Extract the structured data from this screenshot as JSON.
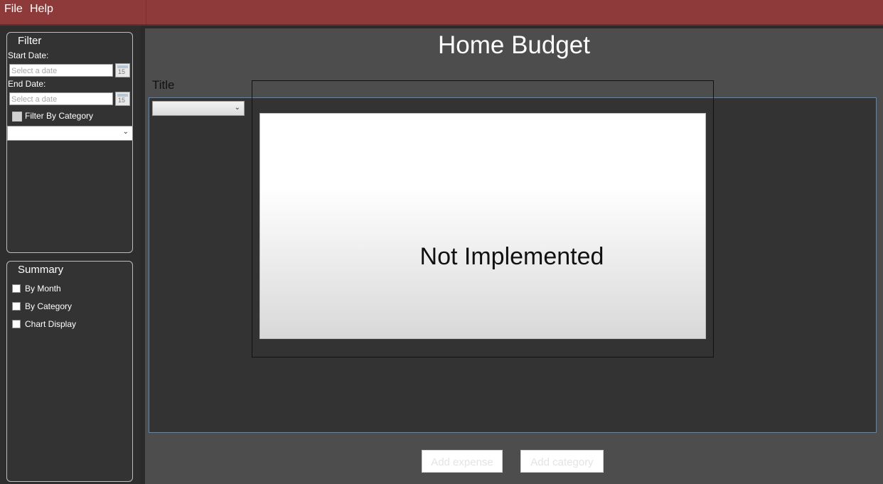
{
  "menu": {
    "file": "File",
    "help": "Help"
  },
  "filter": {
    "title": "Filter",
    "start_label": "Start Date:",
    "end_label": "End Date:",
    "date_placeholder": "Select a date",
    "calendar_day": "15",
    "filter_by_category": "Filter By Category",
    "category_value": ""
  },
  "summary": {
    "title": "Summary",
    "options": [
      "By Month",
      "By Category",
      "Chart Display"
    ]
  },
  "main": {
    "title": "Home Budget",
    "chart_title_label": "Title",
    "chart_message": "Not Implemented",
    "add_expense": "Add expense",
    "add_category": "Add category"
  }
}
